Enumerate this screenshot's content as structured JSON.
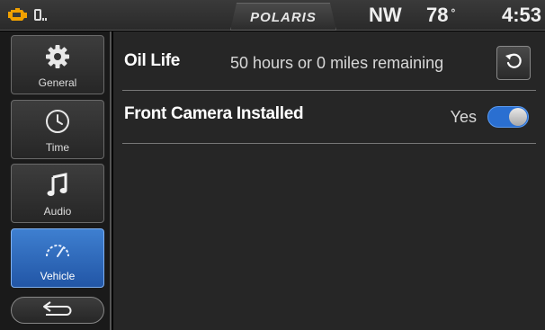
{
  "statusbar": {
    "icons": [
      "engine-warning-icon",
      "phone-signal-icon"
    ],
    "brand": "POLARIS",
    "heading": "NW",
    "temperature": "78",
    "degree": "°",
    "clock": "4:53",
    "colors": {
      "engine_warning": "#f0a000"
    }
  },
  "sidebar": {
    "items": [
      {
        "label": "General",
        "icon": "gear-icon",
        "active": false
      },
      {
        "label": "Time",
        "icon": "clock-icon",
        "active": false
      },
      {
        "label": "Audio",
        "icon": "music-note-icon",
        "active": false
      },
      {
        "label": "Vehicle",
        "icon": "speedometer-icon",
        "active": true
      }
    ],
    "back_icon": "back-arrow-icon"
  },
  "settings": {
    "oil_life": {
      "label": "Oil Life",
      "value": "50 hours or 0 miles remaining",
      "action_icon": "reset-icon"
    },
    "front_camera": {
      "label": "Front Camera Installed",
      "value": "Yes",
      "enabled": true
    }
  },
  "colors": {
    "active_blue": "#2e6dc2",
    "toggle_on": "#2a6fd1",
    "panel_bg": "#262626"
  }
}
